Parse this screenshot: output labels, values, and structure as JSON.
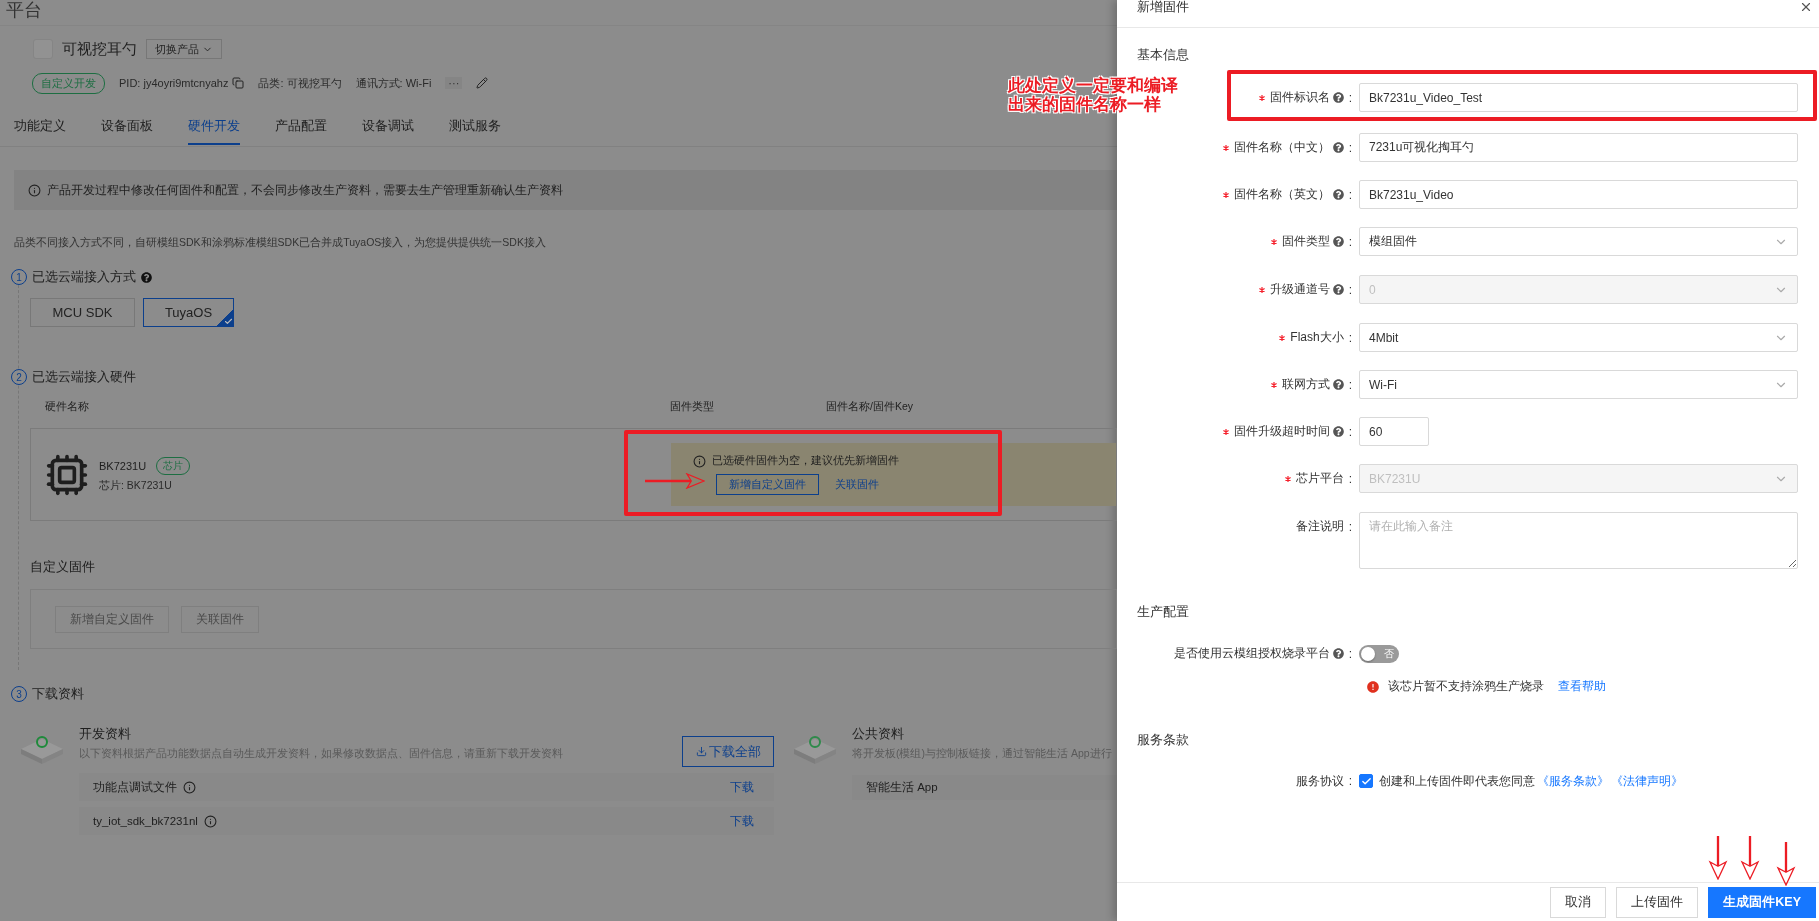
{
  "page": {
    "brand": "平台",
    "product": {
      "name": "可视挖耳勺",
      "switch_button": "切换产品"
    },
    "meta": {
      "tag": "自定义开发",
      "pid": "PID: jy4oyri9mtcnyahz",
      "category": "品类: 可视挖耳勺",
      "protocol": "通讯方式: Wi-Fi",
      "more": "···"
    },
    "tabs": [
      {
        "label": "功能定义",
        "selected": false
      },
      {
        "label": "设备面板",
        "selected": false
      },
      {
        "label": "硬件开发",
        "selected": true
      },
      {
        "label": "产品配置",
        "selected": false
      },
      {
        "label": "设备调试",
        "selected": false
      },
      {
        "label": "测试服务",
        "selected": false
      }
    ],
    "notice": "产品开发过程中修改任何固件和配置，不会同步修改生产资料，需要去生产管理重新确认生产资料",
    "hint": "品类不同接入方式不同，自研模组SDK和涂鸦标准模组SDK已合并成TuyaOS接入，为您提供提供统一SDK接入",
    "steps": [
      {
        "number": "1",
        "title": "已选云端接入方式"
      },
      {
        "number": "2",
        "title": "已选云端接入硬件"
      },
      {
        "number": "3",
        "title": "下载资料"
      }
    ],
    "access_options": [
      {
        "label": "MCU SDK",
        "selected": false
      },
      {
        "label": "TuyaOS",
        "selected": true
      }
    ],
    "hardware_table": {
      "columns": [
        "硬件名称",
        "固件类型",
        "固件名称/固件Key"
      ],
      "rows": [
        {
          "name": "BK7231U",
          "tag": "芯片",
          "chip": "芯片: BK7231U",
          "alert": {
            "text": "已选硬件固件为空，建议优先新增固件",
            "add_button": "新增自定义固件",
            "link": "关联固件"
          }
        }
      ]
    },
    "custom_firmware": {
      "title": "自定义固件",
      "buttons": [
        {
          "label": "新增自定义固件",
          "disabled": true
        },
        {
          "label": "关联固件",
          "disabled": true
        }
      ]
    },
    "downloads": {
      "dev": {
        "title": "开发资料",
        "description": "以下资料根据产品功能数据点自动生成开发资料，如果修改数据点、固件信息，请重新下载开发资料",
        "download_all": "下载全部",
        "files": [
          {
            "name": "功能点调试文件",
            "action": "下载"
          },
          {
            "name": "ty_iot_sdk_bk7231nl",
            "action": "下载"
          }
        ]
      },
      "public": {
        "title": "公共资料",
        "description": "将开发板(模组)与控制板链接，通过智能生活 App进行",
        "items": [
          "智能生活 App"
        ]
      }
    }
  },
  "drawer": {
    "title": "新增固件",
    "label_suffix": ":",
    "sections": [
      {
        "title": "基本信息"
      },
      {
        "title": "生产配置"
      },
      {
        "title": "服务条款"
      }
    ],
    "fields": [
      {
        "label": "固件标识名",
        "required": true,
        "help": true,
        "kind": "text",
        "value": "Bk7231u_Video_Test",
        "disabled": false
      },
      {
        "label": "固件名称（中文）",
        "required": true,
        "help": true,
        "kind": "text",
        "value": "7231u可视化掏耳勺",
        "disabled": false
      },
      {
        "label": "固件名称（英文）",
        "required": true,
        "help": true,
        "kind": "text",
        "value": "Bk7231u_Video",
        "disabled": false
      },
      {
        "label": "固件类型",
        "required": true,
        "help": true,
        "kind": "select",
        "value": "模组固件",
        "disabled": false
      },
      {
        "label": "升级通道号",
        "required": true,
        "help": true,
        "kind": "select",
        "value": "0",
        "disabled": true
      },
      {
        "label": "Flash大小",
        "required": true,
        "help": false,
        "kind": "select",
        "value": "4Mbit",
        "disabled": false
      },
      {
        "label": "联网方式",
        "required": true,
        "help": true,
        "kind": "select",
        "value": "Wi-Fi",
        "disabled": false
      },
      {
        "label": "固件升级超时时间",
        "required": true,
        "help": true,
        "kind": "short",
        "value": "60",
        "disabled": false
      },
      {
        "label": "芯片平台",
        "required": true,
        "help": false,
        "kind": "select",
        "value": "BK7231U",
        "disabled": true
      },
      {
        "label": "备注说明",
        "required": false,
        "help": false,
        "kind": "textarea",
        "placeholder": "请在此输入备注",
        "disabled": false
      }
    ],
    "production": {
      "label": "是否使用云模组授权烧录平台",
      "help": true,
      "toggle": {
        "on": false,
        "text": "否"
      },
      "warning": "该芯片暂不支持涂鸦生产烧录",
      "help_link": "查看帮助"
    },
    "agreement": {
      "label": "服务协议",
      "checked": true,
      "text": "创建和上传固件即代表您同意",
      "links": [
        "《服务条款》",
        "《法律声明》"
      ]
    },
    "buttons": [
      {
        "label": "取消",
        "kind": "default"
      },
      {
        "label": "上传固件",
        "kind": "default"
      },
      {
        "label": "生成固件KEY",
        "kind": "primary"
      }
    ]
  },
  "annotation": {
    "note_lines": [
      "此处定义一定要和编译",
      "出来的固件名称一样"
    ]
  }
}
